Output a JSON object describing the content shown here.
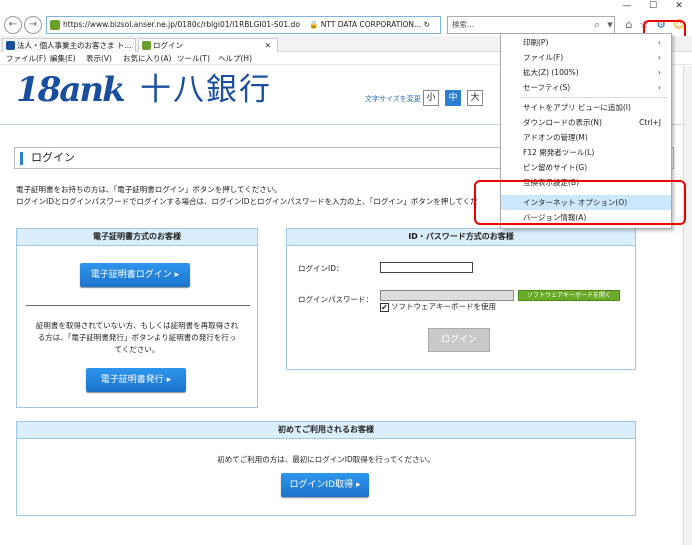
{
  "window": {
    "min": "—",
    "max": "☐",
    "close": "✕"
  },
  "nav": {
    "back": "←",
    "forward": "→"
  },
  "address": {
    "url": "https://www.bizsol.anser.ne.jp/0180c/rblgi01/I1RBLGI01-S01.do",
    "cert": "NTT DATA CORPORATION...",
    "refresh": "↻"
  },
  "search": {
    "placeholder": "検索...",
    "icon": "search-icon",
    "dropdown": "▾"
  },
  "toolbar": {
    "home": "⌂",
    "star": "☆",
    "gear": "⚙",
    "smiley": "☺"
  },
  "tabs": [
    {
      "label": "法人・個人事業主のお客さま ト..."
    },
    {
      "label": "ログイン",
      "close": "✕"
    }
  ],
  "menubar": [
    "ファイル(F)",
    "編集(E)",
    "表示(V)",
    "お気に入り(A)",
    "ツール(T)",
    "ヘルプ(H)"
  ],
  "logo": {
    "en": "18ank",
    "jp": "十八銀行"
  },
  "fontsize": {
    "label": "文字サイズを変更",
    "small": "小",
    "medium": "中",
    "large": "大"
  },
  "page": {
    "title": "ログイン",
    "intro1": "電子証明書をお持ちの方は、「電子証明書ログイン」ボタンを押してください。",
    "intro2": "ログインIDとログインパスワードでログインする場合は、ログインIDとログインパスワードを入力の上、「ログイン」ボタンを押してくだ"
  },
  "cert_panel": {
    "header": "電子証明書方式のお客様",
    "login_button": "電子証明書ログイン ▸",
    "note1": "証明書を取得されていない方、もしくは証明書を再取得され",
    "note2": "る方は、「電子証明書発行」ボタンより証明書の発行を行っ",
    "note3": "てください。",
    "issue_button": "電子証明書発行 ▸"
  },
  "id_panel": {
    "header": "ID・パスワード方式のお客様",
    "id_label": "ログインID：",
    "pw_label": "ログインパスワード：",
    "keyboard_button": "ソフトウェアキーボードを開く",
    "keyboard_check": "ソフトウェアキーボードを使用",
    "login_button": "ログイン"
  },
  "first_panel": {
    "header": "初めてご利用されるお客様",
    "text": "初めてご利用の方は、最初にログインID取得を行ってください。",
    "button": "ログインID取得 ▸"
  },
  "tools_menu": {
    "items": [
      {
        "label": "印刷(P)",
        "shortcut": "›"
      },
      {
        "label": "ファイル(F)",
        "shortcut": "›"
      },
      {
        "label": "拡大(Z) (100%)",
        "shortcut": "›"
      },
      {
        "label": "セーフティ(S)",
        "shortcut": "›"
      },
      {
        "label": "サイトをアプリ ビューに追加(I)",
        "shortcut": ""
      },
      {
        "label": "ダウンロードの表示(N)",
        "shortcut": "Ctrl+J"
      },
      {
        "label": "アドオンの管理(M)",
        "shortcut": ""
      },
      {
        "label": "F12 開発者ツール(L)",
        "shortcut": ""
      },
      {
        "label": "ピン留めサイト(G)",
        "shortcut": ""
      },
      {
        "label": "互換表示設定(B)",
        "shortcut": ""
      },
      {
        "label": "インターネット オプション(O)",
        "shortcut": ""
      },
      {
        "label": "バージョン情報(A)",
        "shortcut": ""
      }
    ]
  },
  "colors": {
    "accent": "#2a7fd4",
    "brand": "#1a4fa0",
    "highlight": "#e00000"
  }
}
